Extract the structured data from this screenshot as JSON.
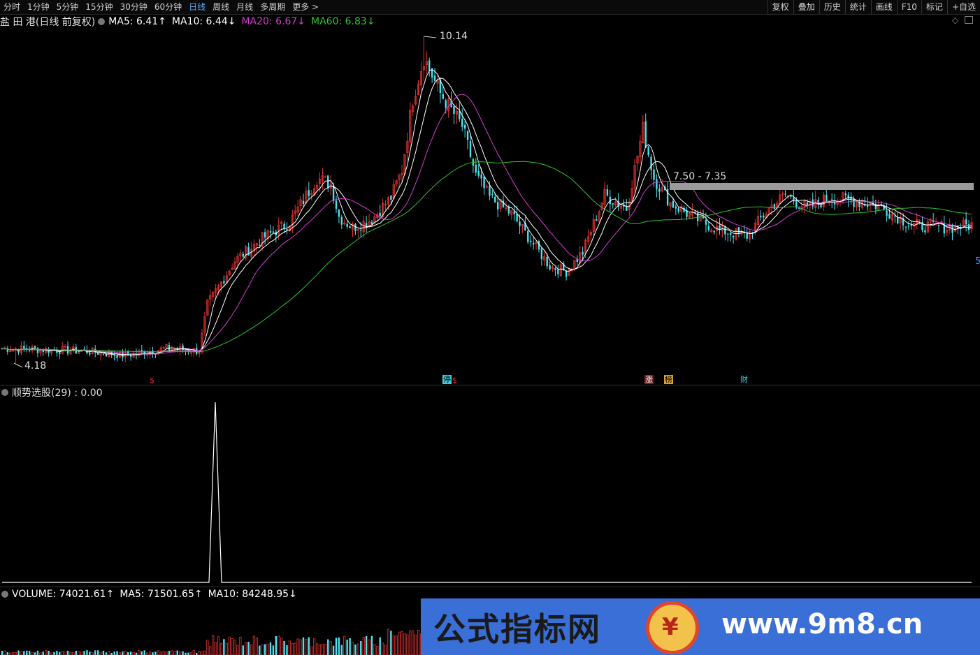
{
  "toolbar": {
    "periods": [
      "分时",
      "1分钟",
      "5分钟",
      "15分钟",
      "30分钟",
      "60分钟",
      "日线",
      "周线",
      "月线",
      "多周期",
      "更多 >"
    ],
    "active_period": "日线",
    "tools": [
      "复权",
      "叠加",
      "历史",
      "统计",
      "画线",
      "F10",
      "标记",
      "+自选"
    ]
  },
  "main_pane": {
    "stock_title": "盐 田 港(日线 前复权)",
    "ma5": {
      "label": "MA5: 6.41↑",
      "color": "#ffffff"
    },
    "ma10": {
      "label": "MA10: 6.44↓",
      "color": "#ffffff"
    },
    "ma20": {
      "label": "MA20: 6.67↓",
      "color": "#d23fd2"
    },
    "ma60": {
      "label": "MA60: 6.83↓",
      "color": "#2fc42f"
    },
    "high_label": "10.14",
    "low_label": "4.18",
    "range_label": "7.50 - 7.35",
    "axis_edge_label": "5",
    "markers": [
      {
        "text": "$",
        "color": "#e03030"
      },
      {
        "text": "停",
        "color": "#3fd0e0"
      },
      {
        "text": "$",
        "color": "#e03030"
      },
      {
        "text": "涨",
        "color": "#e03030"
      },
      {
        "text": "榜",
        "color": "#e0a030"
      },
      {
        "text": "财",
        "color": "#3fd0e0"
      }
    ]
  },
  "indicator_pane": {
    "label": "顺势选股(29) : 0.00"
  },
  "volume_pane": {
    "volume": "VOLUME: 74021.61↑",
    "ma5": "MA5: 71501.65↑",
    "ma10": "MA10: 84248.95↓"
  },
  "watermark": {
    "left_text": "公式指标网",
    "logo_text": "¥",
    "right_text": "www.9m8.cn"
  },
  "colors": {
    "up": "#e03030",
    "down": "#4fe0f0",
    "ma5": "#ffffff",
    "ma10": "#ffffff",
    "ma20": "#d23fd2",
    "ma60": "#2fc42f",
    "background": "#000000"
  }
}
